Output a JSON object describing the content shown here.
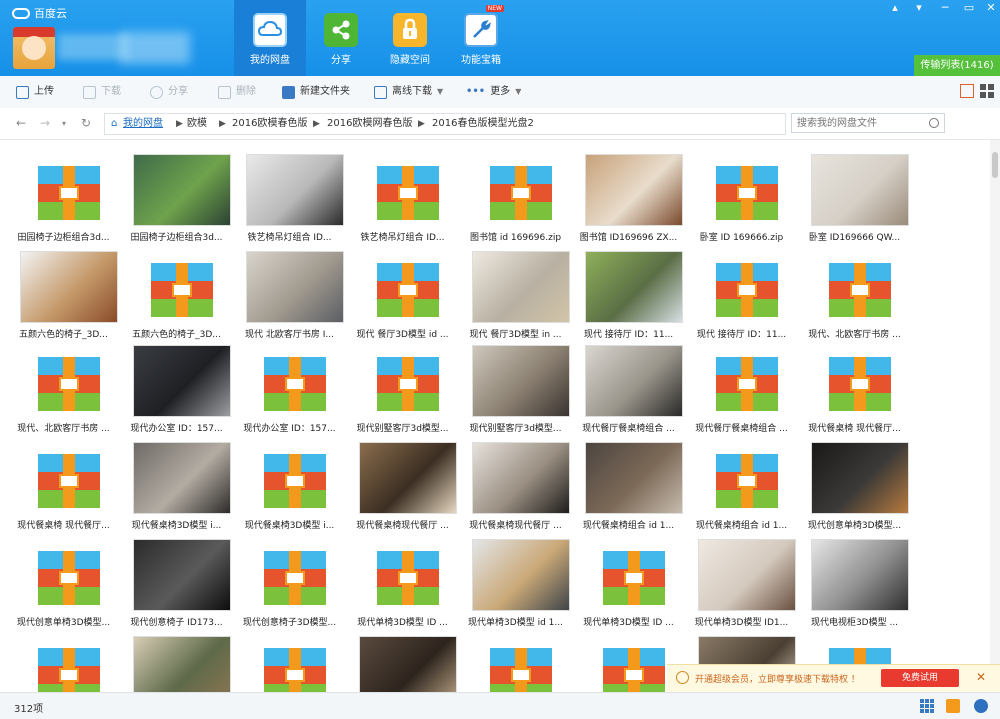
{
  "app": {
    "title": "百度云"
  },
  "nav": [
    {
      "label": "我的网盘",
      "icon": "cloud-icon",
      "active": true
    },
    {
      "label": "分享",
      "icon": "share-icon",
      "active": false
    },
    {
      "label": "隐藏空间",
      "icon": "lock-icon",
      "active": false
    },
    {
      "label": "功能宝箱",
      "icon": "wrench-icon",
      "active": false,
      "badge": "NEW"
    }
  ],
  "transfer_list": "传输列表(1416)",
  "toolbar": {
    "upload": "上传",
    "download": "下载",
    "share": "分享",
    "delete": "删除",
    "new_folder": "新建文件夹",
    "offline_download": "离线下载",
    "more": "更多"
  },
  "breadcrumb": [
    "我的网盘",
    "欧模",
    "2016欧模春色版",
    "2016欧模网春色版",
    "2016春色版模型光盘2"
  ],
  "search": {
    "placeholder": "搜索我的网盘文件"
  },
  "files": [
    {
      "name": "田园椅子边柜组合3d...",
      "kind": "zip"
    },
    {
      "name": "田园椅子边柜组合3d...",
      "kind": "photo",
      "colors": [
        "#3f6b4a",
        "#2c4233",
        "#6fa34c"
      ]
    },
    {
      "name": "铁艺椅吊灯组合   ID...",
      "kind": "photo",
      "colors": [
        "#e9e9e9",
        "#2a2a2a",
        "#b9b9b9"
      ]
    },
    {
      "name": "铁艺椅吊灯组合   ID...",
      "kind": "zip"
    },
    {
      "name": "图书馆 id 169696.zip",
      "kind": "zip"
    },
    {
      "name": "图书馆 ID169696 ZX...",
      "kind": "photo",
      "colors": [
        "#c8a27a",
        "#7a4a2c",
        "#e8dccb"
      ]
    },
    {
      "name": "卧室 ID 169666.zip",
      "kind": "zip"
    },
    {
      "name": "卧室 ID169666 QW...",
      "kind": "photo",
      "colors": [
        "#e8e4de",
        "#9b8b7a",
        "#d5cfc6"
      ]
    },
    {
      "name": "五颜六色的椅子_3D...",
      "kind": "photo",
      "colors": [
        "#f3f3f3",
        "#8a4b2a",
        "#c59a6a"
      ]
    },
    {
      "name": "五颜六色的椅子_3D...",
      "kind": "zip"
    },
    {
      "name": "现代 北欧客厅书房 I...",
      "kind": "photo",
      "colors": [
        "#d9d4cc",
        "#5b5e63",
        "#a19a8f"
      ]
    },
    {
      "name": "现代 餐厅3D模型 id ...",
      "kind": "zip"
    },
    {
      "name": "现代 餐厅3D模型 in ...",
      "kind": "photo",
      "colors": [
        "#eee9e0",
        "#d2c4a8",
        "#b8b0a2"
      ]
    },
    {
      "name": "现代 接待厅   ID：11...",
      "kind": "photo",
      "colors": [
        "#8fb05a",
        "#d7dfe3",
        "#5a6e45"
      ]
    },
    {
      "name": "现代 接待厅   ID：11...",
      "kind": "zip"
    },
    {
      "name": "现代、北欧客厅书房 ...",
      "kind": "zip"
    },
    {
      "name": "现代、北欧客厅书房 ...",
      "kind": "zip"
    },
    {
      "name": "现代办公室   ID：157...",
      "kind": "photo",
      "colors": [
        "#3a3d42",
        "#9c9ea1",
        "#1e2024"
      ]
    },
    {
      "name": "现代办公室   ID：157...",
      "kind": "zip"
    },
    {
      "name": "现代别墅客厅3d模型...",
      "kind": "zip"
    },
    {
      "name": "现代别墅客厅3d模型...",
      "kind": "photo",
      "colors": [
        "#cfc8bd",
        "#3a3430",
        "#8a7f70"
      ]
    },
    {
      "name": "现代餐厅餐桌椅组合 ...",
      "kind": "photo",
      "colors": [
        "#d9d6d0",
        "#2b2a29",
        "#9a958b"
      ]
    },
    {
      "name": "现代餐厅餐桌椅组合 ...",
      "kind": "zip"
    },
    {
      "name": "现代餐桌椅 现代餐厅...",
      "kind": "zip"
    },
    {
      "name": "现代餐桌椅 现代餐厅...",
      "kind": "zip"
    },
    {
      "name": "现代餐桌椅3D模型 i...",
      "kind": "photo",
      "colors": [
        "#6f6a66",
        "#2d2b29",
        "#b3aca3"
      ]
    },
    {
      "name": "现代餐桌椅3D模型 i...",
      "kind": "zip"
    },
    {
      "name": "现代餐桌椅现代餐厅 ...",
      "kind": "photo",
      "colors": [
        "#8a6d4d",
        "#e6d7c0",
        "#3b2e22"
      ]
    },
    {
      "name": "现代餐桌椅现代餐厅 ...",
      "kind": "photo",
      "colors": [
        "#e7e2dc",
        "#1f1d1b",
        "#9a8f82"
      ]
    },
    {
      "name": "现代餐桌椅组合 id 1...",
      "kind": "photo",
      "colors": [
        "#4c4540",
        "#c7bcae",
        "#7d6a58"
      ]
    },
    {
      "name": "现代餐桌椅组合 id 1...",
      "kind": "zip"
    },
    {
      "name": "现代创意单椅3D模型...",
      "kind": "photo",
      "colors": [
        "#1a1918",
        "#b77a3e",
        "#3c3a38"
      ]
    },
    {
      "name": "现代创意单椅3D模型...",
      "kind": "zip"
    },
    {
      "name": "现代创意椅子 ID173...",
      "kind": "photo",
      "colors": [
        "#2b2b2b",
        "#0d0d0d",
        "#5a5a5a"
      ]
    },
    {
      "name": "现代创意椅子3D模型...",
      "kind": "zip"
    },
    {
      "name": "现代单椅3D模型 ID ...",
      "kind": "zip"
    },
    {
      "name": "现代单椅3D模型 id 1...",
      "kind": "photo",
      "colors": [
        "#e3e5e7",
        "#3f4449",
        "#c9a877"
      ]
    },
    {
      "name": "现代单椅3D模型 ID ...",
      "kind": "zip"
    },
    {
      "name": "现代单椅3D模型 ID1...",
      "kind": "photo",
      "colors": [
        "#efe9e2",
        "#6b5141",
        "#d4c9bd"
      ]
    },
    {
      "name": "现代电视柜3D模型 ...",
      "kind": "photo",
      "colors": [
        "#e6e6e6",
        "#2f2f2f",
        "#8f8f8f"
      ]
    },
    {
      "name": "",
      "kind": "zip"
    },
    {
      "name": "",
      "kind": "photo",
      "colors": [
        "#d8cdb6",
        "#8d7652",
        "#5e6a4a"
      ]
    },
    {
      "name": "",
      "kind": "zip"
    },
    {
      "name": "",
      "kind": "photo",
      "colors": [
        "#5a4a3e",
        "#c4ab8b",
        "#2d241d"
      ]
    },
    {
      "name": "",
      "kind": "zip"
    },
    {
      "name": "",
      "kind": "zip"
    },
    {
      "name": "",
      "kind": "photo",
      "colors": [
        "#8a7a66",
        "#e8dcc8",
        "#4a3f33"
      ]
    },
    {
      "name": "",
      "kind": "zip"
    }
  ],
  "promo": {
    "text": "开通超级会员，立即尊享极速下载特权 ！",
    "button": "免费试用"
  },
  "status": {
    "count": "312项"
  }
}
